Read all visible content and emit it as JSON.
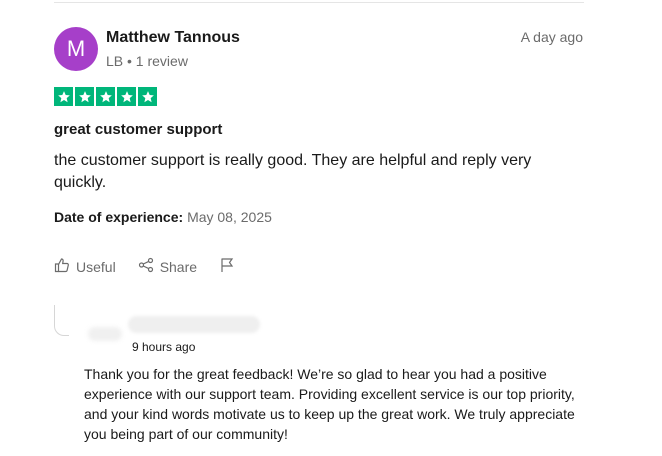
{
  "review": {
    "avatar_initial": "M",
    "avatar_color": "#a63fc9",
    "reviewer_name": "Matthew Tannous",
    "reviewer_meta": "LB • 1 review",
    "date_ago": "A day ago",
    "rating": 5,
    "rating_max": 5,
    "star_color": "#00b67a",
    "title": "great customer support",
    "text": "the customer support is really good. They are helpful and reply very quickly.",
    "experience_label": "Date of experience:",
    "experience_date": "May 08, 2025"
  },
  "actions": {
    "useful_label": "Useful",
    "share_label": "Share",
    "icons": [
      "thumbs-up-icon",
      "share-icon",
      "flag-icon"
    ]
  },
  "reply": {
    "time_ago": "9 hours ago",
    "text": "Thank you for the great feedback! We’re so glad to hear you had a positive experience with our support team. Providing excellent service is our top priority, and your kind words motivate us to keep up the great work. We truly appreciate you being part of our community!"
  }
}
